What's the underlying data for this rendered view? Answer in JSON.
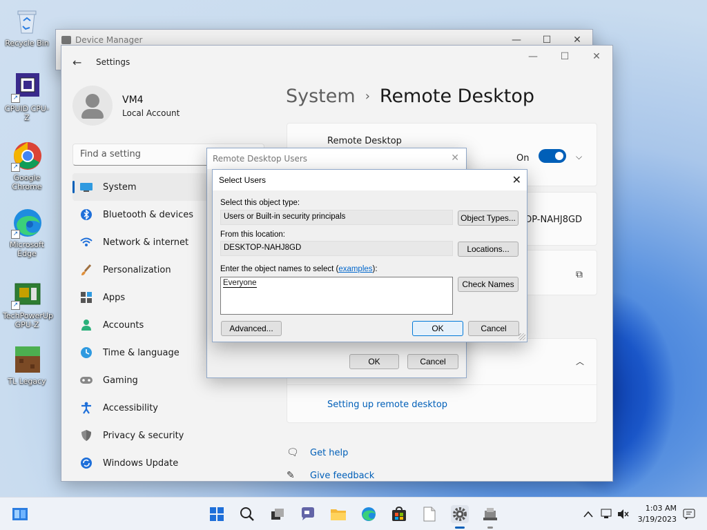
{
  "desktop": {
    "icons": [
      {
        "label": "Recycle Bin",
        "icon": "recycle-bin-icon"
      },
      {
        "label": "CPUID CPU-Z",
        "icon": "cpu-z-icon"
      },
      {
        "label": "Google Chrome",
        "icon": "chrome-icon"
      },
      {
        "label": "Microsoft Edge",
        "icon": "edge-icon"
      },
      {
        "label": "TechPowerUp GPU-Z",
        "icon": "gpu-z-icon"
      },
      {
        "label": "TL Legacy",
        "icon": "tl-legacy-icon"
      }
    ]
  },
  "device_manager": {
    "title": "Device Manager"
  },
  "settings": {
    "title": "Settings",
    "profile": {
      "name": "VM4",
      "subtitle": "Local Account"
    },
    "search_placeholder": "Find a setting",
    "nav": [
      {
        "label": "System",
        "icon": "system-icon",
        "active": true
      },
      {
        "label": "Bluetooth & devices",
        "icon": "bluetooth-icon"
      },
      {
        "label": "Network & internet",
        "icon": "network-icon"
      },
      {
        "label": "Personalization",
        "icon": "brush-icon"
      },
      {
        "label": "Apps",
        "icon": "apps-icon"
      },
      {
        "label": "Accounts",
        "icon": "accounts-icon"
      },
      {
        "label": "Time & language",
        "icon": "clock-icon"
      },
      {
        "label": "Gaming",
        "icon": "gamepad-icon"
      },
      {
        "label": "Accessibility",
        "icon": "accessibility-icon"
      },
      {
        "label": "Privacy & security",
        "icon": "shield-icon"
      },
      {
        "label": "Windows Update",
        "icon": "update-icon"
      }
    ],
    "breadcrumb": {
      "parent": "System",
      "current": "Remote Desktop"
    },
    "remote_desktop": {
      "label": "Remote Desktop",
      "toggle_text": "On",
      "toggle_on": true
    },
    "pc_name_fragment": "OP-NAHJ8GD",
    "setup_link": "Setting up remote desktop",
    "get_help": "Get help",
    "give_feedback": "Give feedback"
  },
  "rdu_dialog": {
    "title": "Remote Desktop Users",
    "ok": "OK",
    "cancel": "Cancel"
  },
  "select_users": {
    "title": "Select Users",
    "object_type_label": "Select this object type:",
    "object_type_value": "Users or Built-in security principals",
    "object_types_button": "Object Types...",
    "location_label": "From this location:",
    "location_value": "DESKTOP-NAHJ8GD",
    "locations_button": "Locations...",
    "names_label": "Enter the object names to select (",
    "names_link": "examples",
    "names_label_end": "):",
    "names_value": "Everyone",
    "check_names_button": "Check Names",
    "advanced_button": "Advanced...",
    "ok": "OK",
    "cancel": "Cancel"
  },
  "taskbar": {
    "time": "1:03 AM",
    "date": "3/19/2023",
    "apps": [
      "start-icon",
      "search-icon",
      "task-view-icon",
      "chat-icon",
      "file-explorer-icon",
      "edge-icon",
      "store-icon",
      "notepad-icon",
      "settings-gear-icon",
      "device-manager-icon"
    ]
  }
}
